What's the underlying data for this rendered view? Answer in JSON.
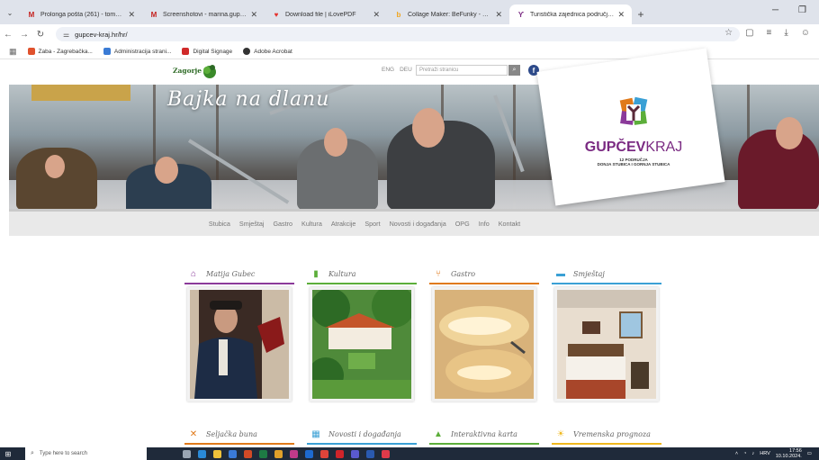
{
  "browser": {
    "tabs": [
      {
        "title": "Prolonga pošta (261) - tomelo...",
        "favicon": "gmail-icon",
        "color": "#c5221f"
      },
      {
        "title": "Screenshotovi - marina.gupce...",
        "favicon": "gmail-icon",
        "color": "#c5221f"
      },
      {
        "title": "Download file | iLovePDF",
        "favicon": "ilovepdf-icon",
        "color": "#e5322d"
      },
      {
        "title": "Collage Maker: BeFunky - Crea...",
        "favicon": "befunky-icon",
        "color": "#f0a51e"
      },
      {
        "title": "Turistička zajednica područja G...",
        "favicon": "tzp-icon",
        "color": "#7a2a82",
        "active": true
      }
    ],
    "url": "gupcev-kraj.hr/hr/",
    "bookmarks": [
      {
        "label": "Zaba - Zagrebačka...",
        "color": "#e0522d"
      },
      {
        "label": "Administracija strani...",
        "color": "#3a7bd5"
      },
      {
        "label": "Digital Signage",
        "color": "#d02a2a"
      },
      {
        "label": "Adobe Acrobat",
        "color": "#333333"
      }
    ]
  },
  "site": {
    "zagorje": "Zagorje",
    "lang": [
      "ENG",
      "DEU"
    ],
    "search_placeholder": "Pretraži stranicu",
    "hero_title": "Bajka na dlanu",
    "brand": {
      "name_bold": "GUPČEV",
      "name_light": "KRAJ",
      "sub1": "12 PODRUČJA",
      "sub2": "DONJA STUBICA I GORNJA STUBICA"
    },
    "menu": [
      "Stubica",
      "Smještaj",
      "Gastro",
      "Kultura",
      "Atrakcije",
      "Sport",
      "Novosti i događanja",
      "OPG",
      "Info",
      "Kontakt"
    ],
    "cards": [
      {
        "label": "Matija Gubec",
        "icon": "monument-icon",
        "color": "#8b3a9a"
      },
      {
        "label": "Kultura",
        "icon": "book-icon",
        "color": "#5cae3a"
      },
      {
        "label": "Gastro",
        "icon": "cutlery-icon",
        "color": "#e07a1a"
      },
      {
        "label": "Smještaj",
        "icon": "bed-icon",
        "color": "#3aa0d5"
      }
    ],
    "cards2": [
      {
        "label": "Seljačka buna",
        "icon": "crossed-swords-icon",
        "color": "#e07a1a"
      },
      {
        "label": "Novosti i događanja",
        "icon": "calendar-icon",
        "color": "#3aa0d5"
      },
      {
        "label": "Interaktivna karta",
        "icon": "map-icon",
        "color": "#5cae3a"
      },
      {
        "label": "Vremenska prognoza",
        "icon": "sun-icon",
        "color": "#f0b81e"
      }
    ]
  },
  "taskbar": {
    "search_placeholder": "Type here to search",
    "lang": "HRV",
    "time": "17:56",
    "date": "10.10.2024."
  }
}
